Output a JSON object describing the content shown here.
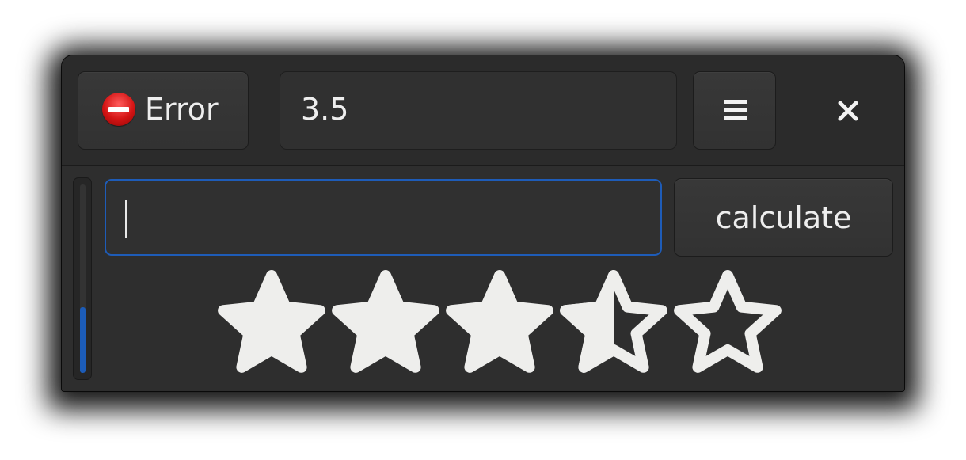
{
  "window": {
    "error_button": {
      "label": "Error",
      "icon": "dialog-error-icon"
    },
    "title": {
      "value": "3.5"
    },
    "menu_button": {
      "icon": "hamburger-menu-icon"
    },
    "close_button": {
      "icon": "close-icon"
    }
  },
  "main": {
    "entry": {
      "value": "",
      "placeholder": ""
    },
    "calculate_button": {
      "label": "calculate"
    },
    "level_bar": {
      "fraction": 0.35
    },
    "rating": {
      "value": 3.5,
      "max": 5
    }
  },
  "colors": {
    "accent": "#1c5cb8",
    "window_bg": "#2e2e2e",
    "text": "#eeeeee",
    "star": "#eeeeec",
    "error_red": "#d41414"
  }
}
